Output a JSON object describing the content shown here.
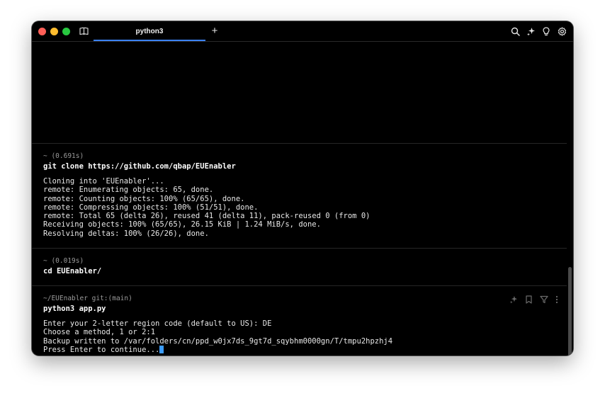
{
  "titlebar": {
    "tab_title": "python3",
    "new_tab_symbol": "+",
    "icons": [
      "book-icon",
      "search-icon",
      "ai-sparkle-icon",
      "lightbulb-icon",
      "settings-gear-icon"
    ]
  },
  "blocks": [
    {
      "meta": "~ (0.691s)",
      "command": "git clone https://github.com/qbap/EUEnabler",
      "output": "Cloning into 'EUEnabler'...\nremote: Enumerating objects: 65, done.\nremote: Counting objects: 100% (65/65), done.\nremote: Compressing objects: 100% (51/51), done.\nremote: Total 65 (delta 26), reused 41 (delta 11), pack-reused 0 (from 0)\nReceiving objects: 100% (65/65), 26.15 KiB | 1.24 MiB/s, done.\nResolving deltas: 100% (26/26), done."
    },
    {
      "meta": "~ (0.019s)",
      "command": "cd EUEnabler/",
      "output": ""
    },
    {
      "meta": "~/EUEnabler git:(main)",
      "command": "python3 app.py",
      "output": "Enter your 2-letter region code (default to US): DE\nChoose a method, 1 or 2:1\nBackup written to /var/folders/cn/ppd_w0jx7ds_9gt7d_sqybhm0000gn/T/tmpu2hpzhj4\nPress Enter to continue..."
    }
  ],
  "colors": {
    "background": "#000000",
    "accent": "#3b82f6",
    "cursor": "#3b9cff"
  }
}
